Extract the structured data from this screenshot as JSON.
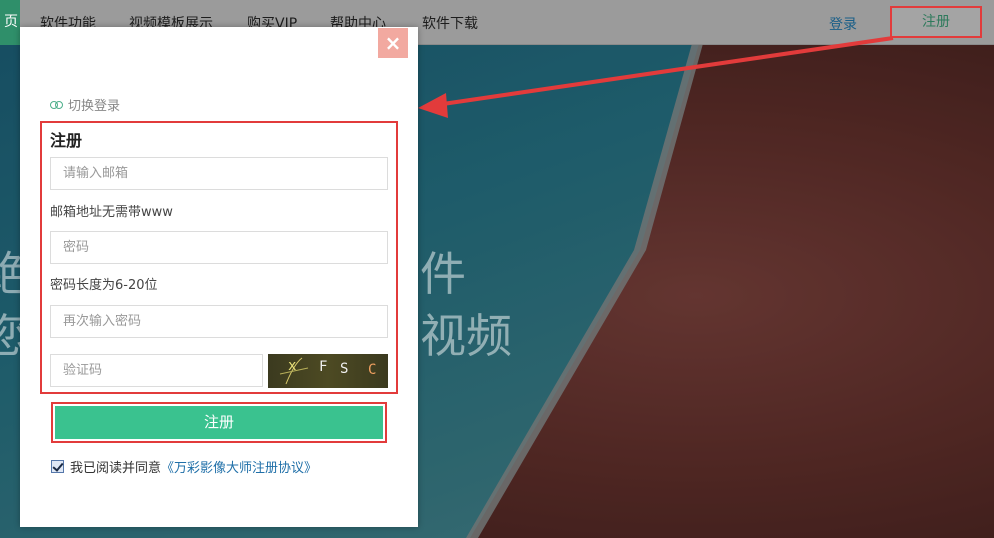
{
  "nav": {
    "edge_label": "页",
    "items": [
      "软件功能",
      "视频模板展示",
      "购买VIP",
      "帮助中心",
      "软件下载"
    ],
    "login": "登录",
    "register": "注册"
  },
  "background": {
    "line1_left": "绝",
    "line2_left": "您",
    "line1_right": "件",
    "line2_right": "视频"
  },
  "modal": {
    "close": "×",
    "switch_login": "切换登录",
    "title": "注册",
    "email_placeholder": "请输入邮箱",
    "email_hint": "邮箱地址无需带www",
    "password_placeholder": "密码",
    "password_hint": "密码长度为6-20位",
    "confirm_placeholder": "再次输入密码",
    "captcha_placeholder": "验证码",
    "captcha_chars": [
      "x",
      "F",
      "S",
      "C"
    ],
    "submit": "注册",
    "agree_text": "我已阅读并同意",
    "agree_link": "《万彩影像大师注册协议》"
  },
  "colors": {
    "accent_green": "#3ac28f",
    "annotation_red": "#e23b3b",
    "link_blue": "#1f6fa8"
  }
}
